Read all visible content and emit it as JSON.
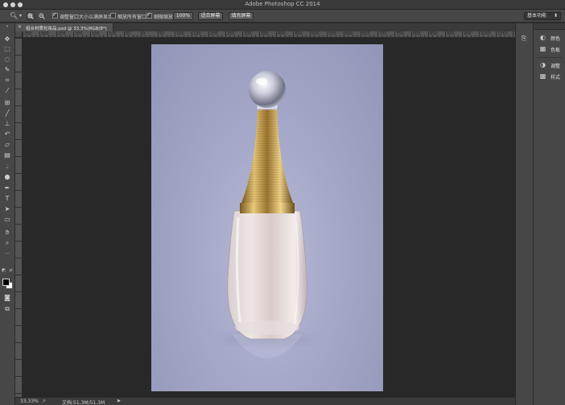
{
  "app": {
    "title": "Adobe Photoshop CC 2014"
  },
  "options_bar": {
    "tool_icon": "zoom-tool-icon",
    "check_resize_windows": {
      "label": "调整窗口大小以满屏显示",
      "checked": true
    },
    "check_zoom_all_windows": {
      "label": "缩放所有窗口",
      "checked": false
    },
    "check_scrubby_zoom": {
      "label": "细微缩放",
      "checked": true
    },
    "btn_100": "100%",
    "btn_fit_screen": "适合屏幕",
    "btn_fill_screen": "填充屏幕",
    "workspace_label": "基本功能"
  },
  "document": {
    "tab_label": "组合材质化妆品.psd @ 33.3%(RGB/8*)",
    "close_glyph": "×"
  },
  "rulers": {
    "horizontal_labels": [
      "350",
      "300",
      "250",
      "200",
      "150",
      "100",
      "50",
      "0",
      "50",
      "100",
      "150",
      "200",
      "250",
      "300",
      "350",
      "400",
      "450",
      "500",
      "550",
      "600",
      "650",
      "700",
      "750",
      "800",
      "850",
      "900",
      "950",
      "1000",
      "1050",
      "1100"
    ]
  },
  "status": {
    "zoom": "33.33%",
    "doc_info": "文档:51.3M/51.3M",
    "arrow": "▶"
  },
  "panels": {
    "items": [
      {
        "label": "颜色",
        "icon": "color-panel-icon",
        "glyph": "◐"
      },
      {
        "label": "色板",
        "icon": "swatches-panel-icon",
        "glyph": "▦"
      },
      {
        "label": "调整",
        "icon": "adjustments-panel-icon",
        "glyph": "◑"
      },
      {
        "label": "样式",
        "icon": "styles-panel-icon",
        "glyph": "▩"
      }
    ]
  },
  "colors": {
    "foreground": "#000000",
    "background": "#ffffff",
    "canvas_backdrop": "#a6a9c9",
    "gold": "#c9a24a"
  }
}
